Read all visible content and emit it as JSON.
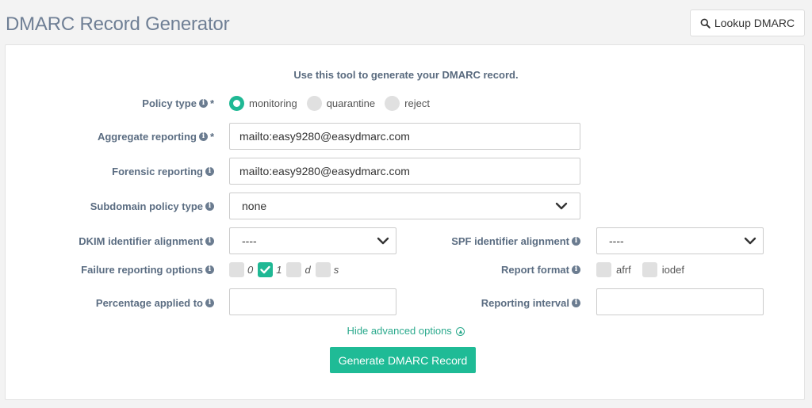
{
  "header": {
    "title": "DMARC Record Generator",
    "lookup_label": "Lookup DMARC"
  },
  "form": {
    "intro": "Use this tool to generate your DMARC record.",
    "policy_type": {
      "label": "Policy type",
      "required": "*",
      "options": [
        "monitoring",
        "quarantine",
        "reject"
      ],
      "selected": "monitoring"
    },
    "aggregate_reporting": {
      "label": "Aggregate reporting",
      "required": "*",
      "value": "mailto:easy9280@easydmarc.com"
    },
    "forensic_reporting": {
      "label": "Forensic reporting",
      "value": "mailto:easy9280@easydmarc.com"
    },
    "subdomain_policy": {
      "label": "Subdomain policy type",
      "value": "none"
    },
    "dkim_alignment": {
      "label": "DKIM identifier alignment",
      "value": "----"
    },
    "spf_alignment": {
      "label": "SPF identifier alignment",
      "value": "----"
    },
    "failure_reporting": {
      "label": "Failure reporting options",
      "options": [
        "0",
        "1",
        "d",
        "s"
      ],
      "checked": [
        "1"
      ]
    },
    "report_format": {
      "label": "Report format",
      "options": [
        "afrf",
        "iodef"
      ]
    },
    "percentage": {
      "label": "Percentage applied to",
      "value": ""
    },
    "reporting_interval": {
      "label": "Reporting interval",
      "value": ""
    },
    "advanced_link": "Hide advanced options",
    "generate_label": "Generate DMARC Record"
  },
  "colors": {
    "accent": "#1fbb96",
    "title": "#6f7f95",
    "label": "#5b6d82"
  },
  "icons": [
    "search-icon",
    "info-icon",
    "chevron-down-icon",
    "checkmark-icon",
    "arrow-up-circle-icon"
  ]
}
